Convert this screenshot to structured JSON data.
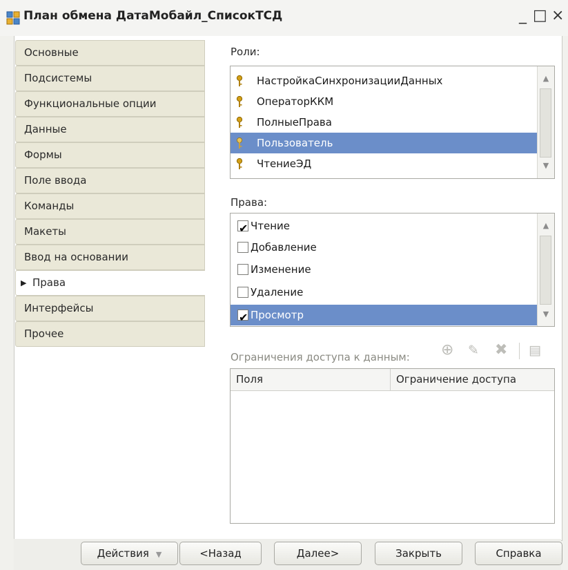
{
  "window": {
    "title": "План обмена ДатаМобайл_СписокТСД",
    "minimize": "_",
    "maximize": "□",
    "close": "×"
  },
  "sidebar": {
    "items": [
      {
        "label": "Основные"
      },
      {
        "label": "Подсистемы"
      },
      {
        "label": "Функциональные опции"
      },
      {
        "label": "Данные"
      },
      {
        "label": "Формы"
      },
      {
        "label": "Поле ввода"
      },
      {
        "label": "Команды"
      },
      {
        "label": "Макеты"
      },
      {
        "label": "Ввод на основании"
      },
      {
        "label": "Права",
        "active": true
      },
      {
        "label": "Интерфейсы"
      },
      {
        "label": "Прочее"
      }
    ]
  },
  "roles": {
    "label": "Роли:",
    "items": [
      "НастройкаСинхронизацииДанных",
      "ОператорККМ",
      "ПолныеПрава",
      "Пользователь",
      "ЧтениеЭД"
    ],
    "selected_index": 3
  },
  "rights": {
    "label": "Права:",
    "items": [
      {
        "label": "Чтение",
        "checked": true
      },
      {
        "label": "Добавление",
        "checked": false
      },
      {
        "label": "Изменение",
        "checked": false
      },
      {
        "label": "Удаление",
        "checked": false
      },
      {
        "label": "Просмотр",
        "checked": true
      }
    ],
    "selected_index": 4
  },
  "restrictions": {
    "label": "Ограничения доступа к данным:",
    "columns": [
      "Поля",
      "Ограничение доступа"
    ]
  },
  "buttons": {
    "actions": "Действия",
    "back": "<Назад",
    "next": "Далее>",
    "close": "Закрыть",
    "help": "Справка"
  },
  "colors": {
    "selection": "#6b8ec9",
    "nav_tab": "#eae8d8",
    "key_icon": "#d4a017"
  }
}
